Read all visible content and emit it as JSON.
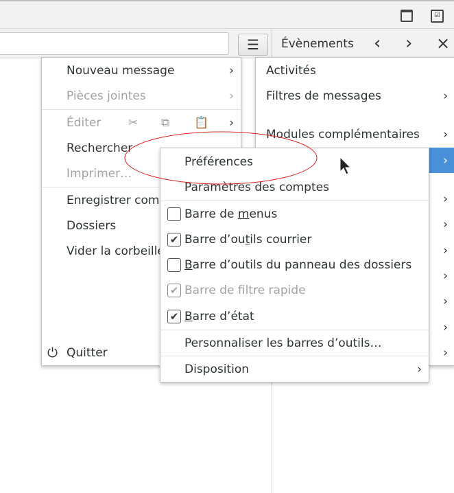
{
  "toolbar": {
    "icons": [
      "calendar-icon",
      "tasks-icon"
    ]
  },
  "panel": {
    "title": "Évènements",
    "prev": "‹",
    "next": "›",
    "close": "×"
  },
  "main_menu": {
    "items": [
      {
        "label": "Nouveau message",
        "disabled": false,
        "submenu": true
      },
      {
        "label": "Pièces jointes",
        "disabled": true,
        "submenu": true
      },
      {
        "label": "Éditer",
        "disabled": true,
        "submenu": true
      },
      {
        "label": "Rechercher",
        "disabled": false,
        "submenu": true
      },
      {
        "label": "Imprimer…",
        "disabled": true
      },
      {
        "label": "Enregistrer com",
        "disabled": false
      },
      {
        "label": "Dossiers",
        "disabled": false
      },
      {
        "label": "Vider la corbeille",
        "disabled": false
      },
      {
        "label": "Quitter",
        "disabled": false
      }
    ]
  },
  "right_menu": {
    "items": [
      {
        "label": "Activités"
      },
      {
        "label": "Filtres de messages"
      },
      {
        "label": "Modules complémentaires"
      }
    ]
  },
  "submenu": {
    "items": [
      {
        "label": "Préférences"
      },
      {
        "label": "Paramètres des comptes"
      },
      {
        "label_a": "Barre de ",
        "label_u": "m",
        "label_b": "enus",
        "checked": false
      },
      {
        "label_a": "Barre d’ou",
        "label_u": "t",
        "label_b": "ils courrier",
        "checked": true
      },
      {
        "label_a": "",
        "label_u": "B",
        "label_b": "arre d’outils du panneau des dossiers",
        "checked": false
      },
      {
        "label_a": "Barre de filtre rapide",
        "label_u": "",
        "label_b": "",
        "checked": true,
        "disabled": true
      },
      {
        "label_a": "",
        "label_u": "B",
        "label_b": "arre d’état",
        "checked": true
      },
      {
        "label": "Personnaliser les barres d’outils…"
      },
      {
        "label": "Disposition",
        "submenu": true
      }
    ]
  },
  "colors": {
    "highlight": "#4a90d9",
    "annotation": "#e02020"
  }
}
